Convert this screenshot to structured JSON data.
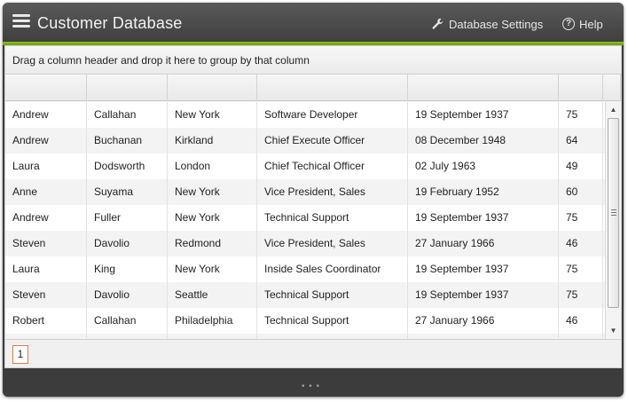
{
  "app": {
    "title": "Customer Database",
    "settings_label": "Database Settings",
    "help_label": "Help",
    "help_glyph": "?"
  },
  "grid": {
    "group_hint": "Drag a column header and drop it here to group by that column",
    "rows": [
      [
        "Andrew",
        "Callahan",
        "New York",
        "Software Developer",
        "19 September 1937",
        "75"
      ],
      [
        "Andrew",
        "Buchanan",
        "Kirkland",
        "Chief Execute Officer",
        "08 December 1948",
        "64"
      ],
      [
        "Laura",
        "Dodsworth",
        "London",
        "Chief Techical Officer",
        "02 July 1963",
        "49"
      ],
      [
        "Anne",
        "Suyama",
        "New York",
        "Vice President, Sales",
        "19 February 1952",
        "60"
      ],
      [
        "Andrew",
        "Fuller",
        "New York",
        "Technical Support",
        "19 September 1937",
        "75"
      ],
      [
        "Steven",
        "Davolio",
        "Redmond",
        "Vice President, Sales",
        "27 January 1966",
        "46"
      ],
      [
        "Laura",
        "King",
        "New York",
        "Inside Sales Coordinator",
        "19 September 1937",
        "75"
      ],
      [
        "Steven",
        "Davolio",
        "Seattle",
        "Technical Support",
        "19 September 1937",
        "75"
      ],
      [
        "Robert",
        "Callahan",
        "Philadelphia",
        "Technical Support",
        "27 January 1966",
        "46"
      ],
      [
        "",
        "",
        "",
        "",
        "",
        ""
      ]
    ]
  },
  "pager": {
    "current_page": "1"
  },
  "footer": {
    "grip": "• • •"
  },
  "colors": {
    "accent": "#8fc21f",
    "titlebar": "#3f3f3f",
    "pager_active_border": "#e07a4a"
  }
}
